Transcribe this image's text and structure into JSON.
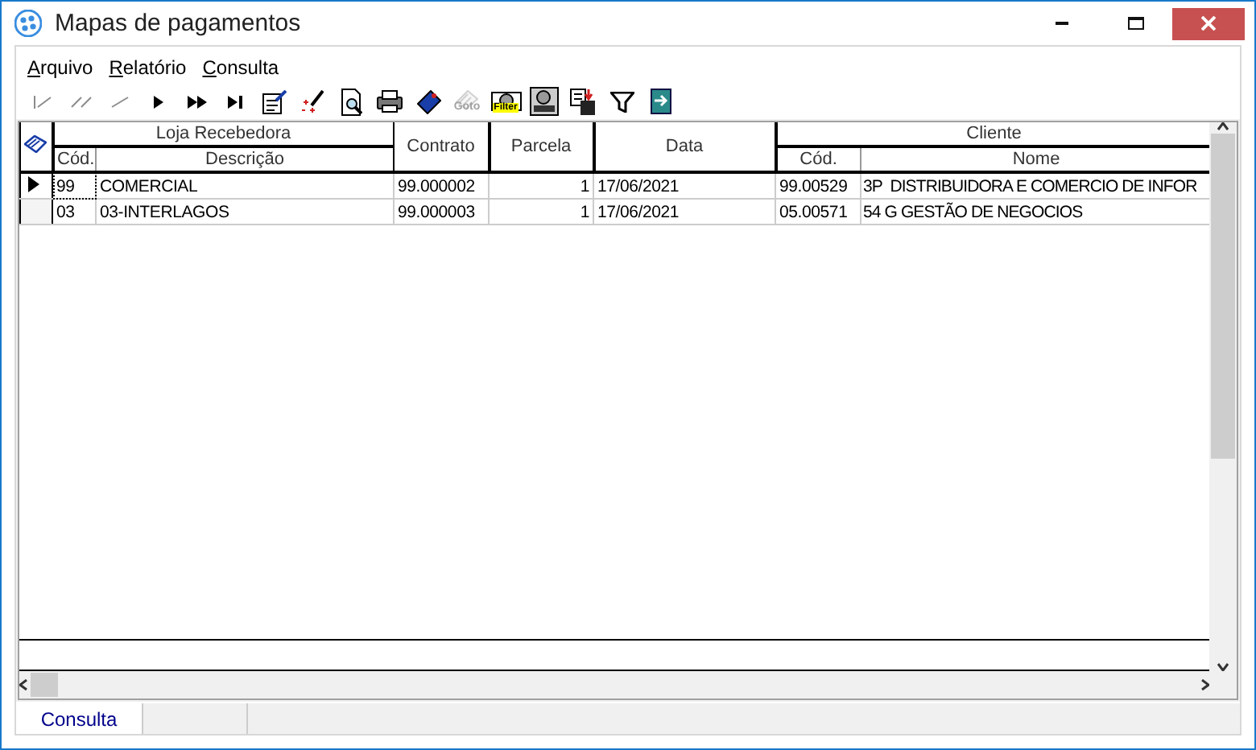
{
  "window": {
    "title": "Mapas de pagamentos"
  },
  "menu": [
    {
      "label": "Arquivo"
    },
    {
      "label": "Relatório"
    },
    {
      "label": "Consulta"
    }
  ],
  "toolbar": [
    {
      "kind": "first",
      "disabled": true
    },
    {
      "kind": "prior-page",
      "disabled": true
    },
    {
      "kind": "prior",
      "disabled": true
    },
    {
      "kind": "next",
      "disabled": false
    },
    {
      "kind": "next-page",
      "disabled": false
    },
    {
      "kind": "last",
      "disabled": false
    },
    {
      "kind": "edit",
      "disabled": false
    },
    {
      "kind": "wand",
      "disabled": false
    },
    {
      "kind": "preview",
      "disabled": false
    },
    {
      "kind": "print",
      "disabled": false
    },
    {
      "kind": "tag",
      "disabled": false
    },
    {
      "kind": "goto",
      "disabled": true,
      "label": "Goto"
    },
    {
      "kind": "filter-lamp",
      "disabled": false,
      "label": "Filter"
    },
    {
      "kind": "lamp",
      "disabled": false
    },
    {
      "kind": "save",
      "disabled": false
    },
    {
      "kind": "funnel",
      "disabled": false
    },
    {
      "kind": "exit",
      "disabled": false
    }
  ],
  "grid": {
    "header": [
      {
        "label": "Loja Recebedora",
        "columns": [
          "Cód.",
          "Descrição"
        ]
      },
      {
        "label": "Contrato"
      },
      {
        "label": "Parcela"
      },
      {
        "label": "Data"
      },
      {
        "label": "Cliente",
        "columns": [
          "Cód.",
          "Nome"
        ]
      }
    ],
    "rows": [
      {
        "selected": true,
        "cells": [
          "99",
          "COMERCIAL",
          "99.000002",
          "1",
          "17/06/2021",
          "99.00529",
          "3P  DISTRIBUIDORA E COMERCIO DE INFOR"
        ]
      },
      {
        "selected": false,
        "cells": [
          "03",
          "03-INTERLAGOS",
          "99.000003",
          "1",
          "17/06/2021",
          "05.00571",
          "54 G GESTÃO DE NEGOCIOS"
        ]
      }
    ]
  },
  "status_bar": {
    "tabs": [
      {
        "label": "Consulta",
        "selected": true
      }
    ]
  }
}
